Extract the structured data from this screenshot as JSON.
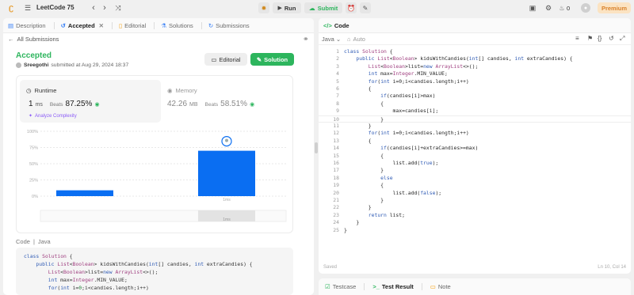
{
  "topbar": {
    "title": "LeetCode 75",
    "run": "Run",
    "submit": "Submit",
    "streak": "0",
    "premium": "Premium"
  },
  "left_tabs": [
    "Description",
    "Accepted",
    "Editorial",
    "Solutions",
    "Submissions"
  ],
  "back": "All Submissions",
  "result": {
    "status": "Accepted",
    "user": "Sreegothi",
    "submitted": "submitted at Aug 29, 2024 18:37",
    "editorial_btn": "Editorial",
    "solution_btn": "Solution"
  },
  "runtime": {
    "label": "Runtime",
    "value": "1",
    "unit": "ms",
    "beats_label": "Beats",
    "beats": "87.25%",
    "analyze": "Analyze Complexity"
  },
  "memory": {
    "label": "Memory",
    "value": "42.26",
    "unit": "MB",
    "beats_label": "Beats",
    "beats": "58.51%"
  },
  "chart_data": {
    "type": "bar",
    "ytick_labels": [
      "100%",
      "75%",
      "50%",
      "25%",
      "0%"
    ],
    "ylim": [
      0,
      100
    ],
    "values": [
      9,
      70
    ],
    "categories": [
      "",
      "1ms"
    ],
    "highlight": "1ms",
    "color": "#0a6ef2",
    "axis_label": "1ms"
  },
  "code_card": {
    "label": "Code",
    "lang": "Java",
    "lines": [
      "class Solution {",
      "    public List<Boolean> kidsWithCandies(int[] candies, int extraCandies) {",
      "        List<Boolean>list=new ArrayList<>();",
      "        int max=Integer.MIN_VALUE;",
      "        for(int i=0;i<candies.length;i++)"
    ]
  },
  "editor": {
    "title": "Code",
    "lang": "Java",
    "mode": "Auto",
    "status_left": "Saved",
    "status_right": "Ln 10, Col 14",
    "lines": [
      "class Solution {",
      "    public List<Boolean> kidsWithCandies(int[] candies, int extraCandies) {",
      "        List<Boolean>list=new ArrayList<>();",
      "        int max=Integer.MIN_VALUE;",
      "        for(int i=0;i<candies.length;i++)",
      "        {",
      "            if(candies[i]>max)",
      "            {",
      "                max=candies[i];",
      "            }",
      "        }",
      "        for(int i=0;i<candies.length;i++)",
      "        {",
      "            if(candies[i]+extraCandies>=max)",
      "            {",
      "                list.add(true);",
      "            }",
      "            else",
      "            {",
      "                list.add(false);",
      "            }",
      "        }",
      "        return list;",
      "    }",
      "}"
    ]
  },
  "bottom_tabs": [
    "Testcase",
    "Test Result",
    "Note"
  ]
}
